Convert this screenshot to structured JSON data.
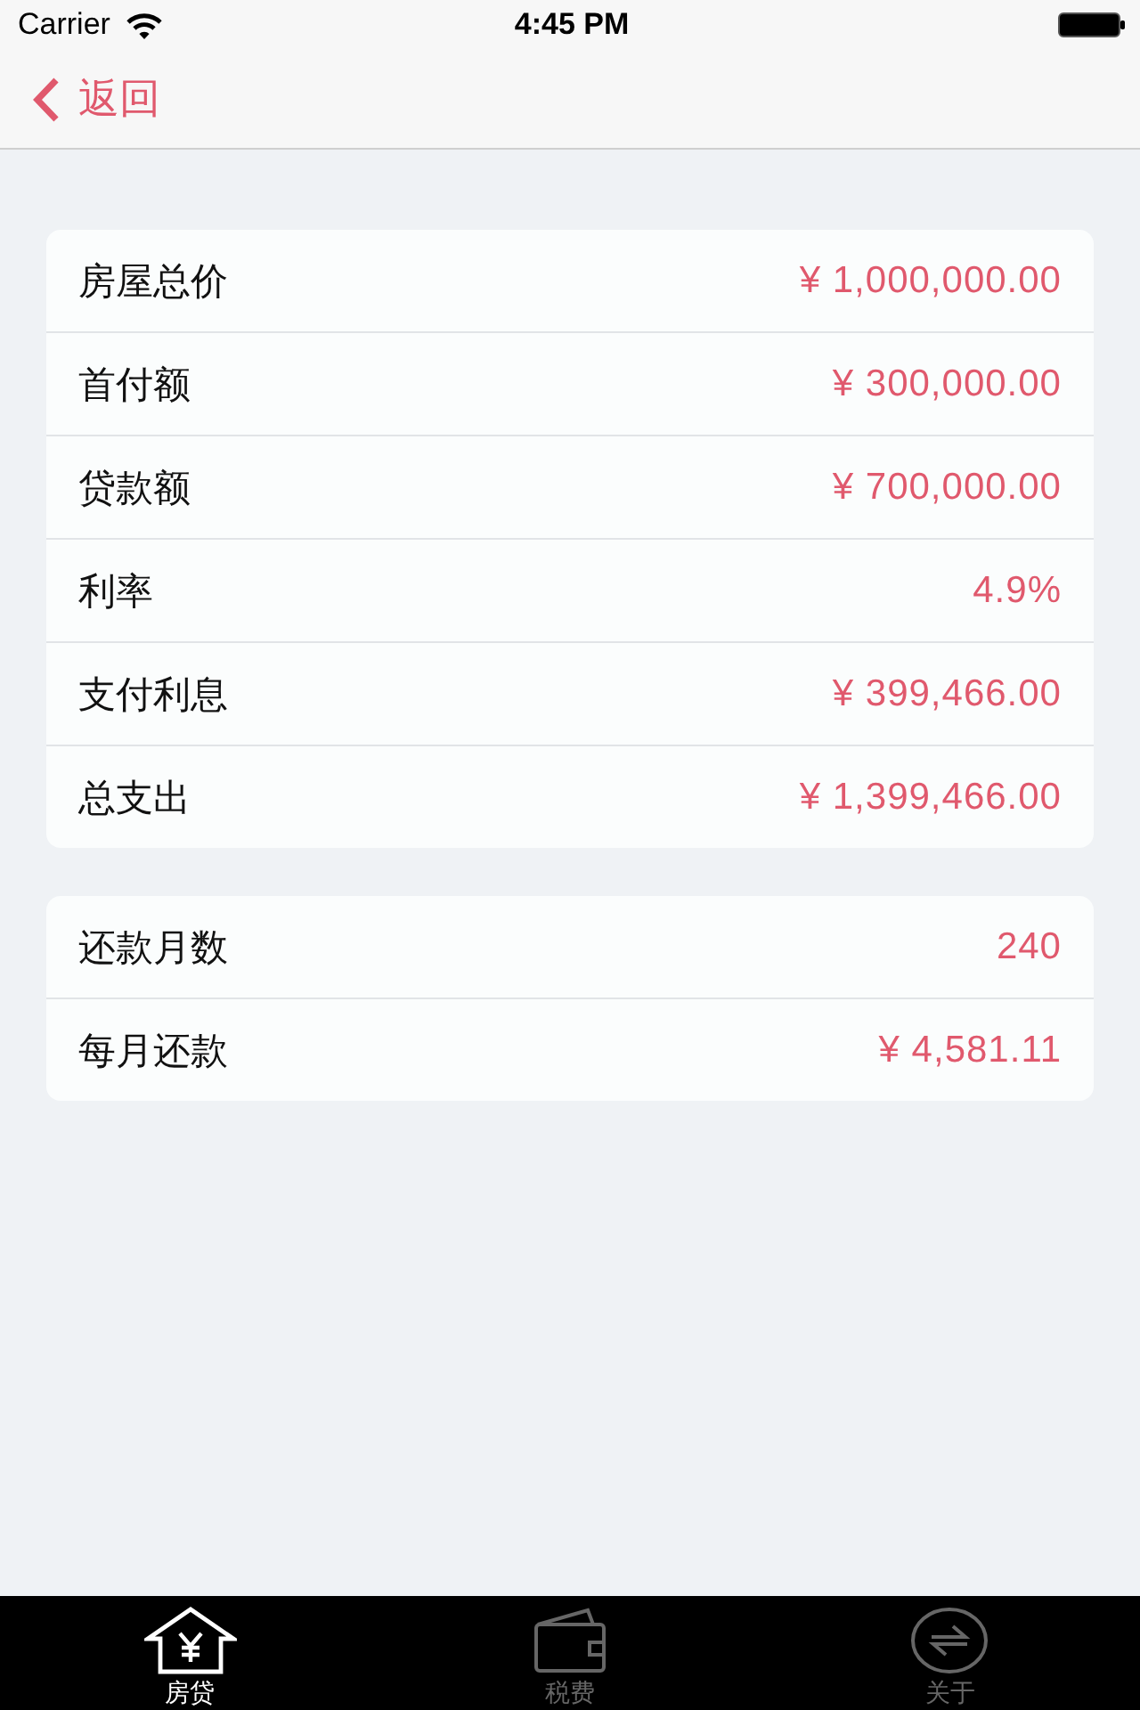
{
  "status_bar": {
    "carrier": "Carrier",
    "time": "4:45 PM"
  },
  "nav_bar": {
    "back_label": "返回"
  },
  "sections": [
    {
      "rows": [
        {
          "label": "房屋总价",
          "value": "¥ 1,000,000.00"
        },
        {
          "label": "首付额",
          "value": "¥ 300,000.00"
        },
        {
          "label": "贷款额",
          "value": "¥ 700,000.00"
        },
        {
          "label": "利率",
          "value": "4.9%"
        },
        {
          "label": "支付利息",
          "value": "¥ 399,466.00"
        },
        {
          "label": "总支出",
          "value": "¥ 1,399,466.00"
        }
      ]
    },
    {
      "rows": [
        {
          "label": "还款月数",
          "value": "240"
        },
        {
          "label": "每月还款",
          "value": "¥ 4,581.11"
        }
      ]
    }
  ],
  "tab_bar": {
    "tabs": [
      {
        "label": "房贷",
        "selected": true,
        "kind": "house"
      },
      {
        "label": "税费",
        "selected": false,
        "kind": "wallet"
      },
      {
        "label": "关于",
        "selected": false,
        "kind": "exchange"
      }
    ]
  }
}
